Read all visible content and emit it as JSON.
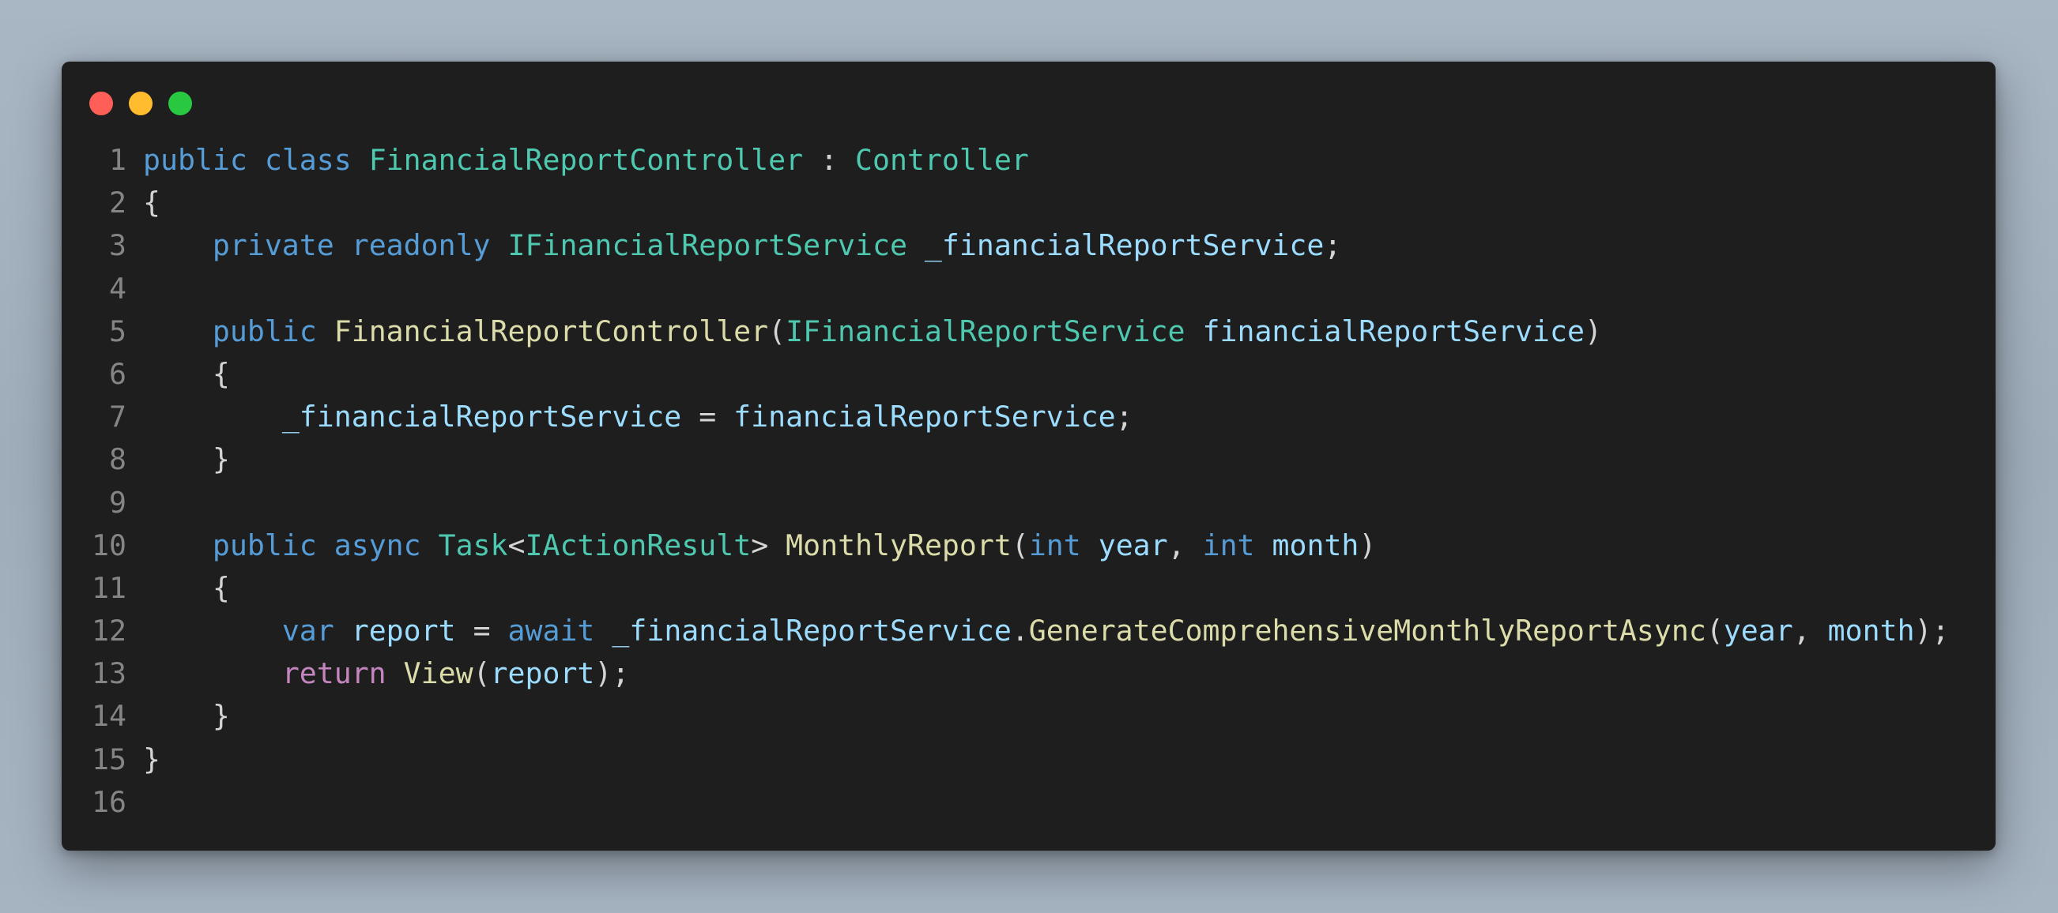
{
  "window": {
    "controls": [
      "close",
      "minimize",
      "maximize"
    ]
  },
  "colors": {
    "background": "#a6b3c1",
    "editor": "#1e1e1e",
    "keyword": "#569cd6",
    "control": "#c586c0",
    "type": "#4ec9b0",
    "function": "#dcdcaa",
    "variable": "#9cdcfe",
    "punctuation": "#d4d4d4",
    "line_number": "#858585"
  },
  "code": {
    "lines": [
      {
        "n": "1",
        "tokens": [
          {
            "t": "public",
            "c": "kw"
          },
          {
            "t": " ",
            "c": "pn"
          },
          {
            "t": "class",
            "c": "kw"
          },
          {
            "t": " ",
            "c": "pn"
          },
          {
            "t": "FinancialReportController",
            "c": "type"
          },
          {
            "t": " : ",
            "c": "pn"
          },
          {
            "t": "Controller",
            "c": "type"
          }
        ]
      },
      {
        "n": "2",
        "tokens": [
          {
            "t": "{",
            "c": "pn"
          }
        ]
      },
      {
        "n": "3",
        "tokens": [
          {
            "t": "    ",
            "c": "pn"
          },
          {
            "t": "private",
            "c": "kw"
          },
          {
            "t": " ",
            "c": "pn"
          },
          {
            "t": "readonly",
            "c": "kw"
          },
          {
            "t": " ",
            "c": "pn"
          },
          {
            "t": "IFinancialReportService",
            "c": "type"
          },
          {
            "t": " ",
            "c": "pn"
          },
          {
            "t": "_financialReportService",
            "c": "var"
          },
          {
            "t": ";",
            "c": "pn"
          }
        ]
      },
      {
        "n": "4",
        "tokens": []
      },
      {
        "n": "5",
        "tokens": [
          {
            "t": "    ",
            "c": "pn"
          },
          {
            "t": "public",
            "c": "kw"
          },
          {
            "t": " ",
            "c": "pn"
          },
          {
            "t": "FinancialReportController",
            "c": "fn"
          },
          {
            "t": "(",
            "c": "pn"
          },
          {
            "t": "IFinancialReportService",
            "c": "type"
          },
          {
            "t": " ",
            "c": "pn"
          },
          {
            "t": "financialReportService",
            "c": "var"
          },
          {
            "t": ")",
            "c": "pn"
          }
        ]
      },
      {
        "n": "6",
        "tokens": [
          {
            "t": "    {",
            "c": "pn"
          }
        ]
      },
      {
        "n": "7",
        "tokens": [
          {
            "t": "        ",
            "c": "pn"
          },
          {
            "t": "_financialReportService",
            "c": "var"
          },
          {
            "t": " = ",
            "c": "pn"
          },
          {
            "t": "financialReportService",
            "c": "var"
          },
          {
            "t": ";",
            "c": "pn"
          }
        ]
      },
      {
        "n": "8",
        "tokens": [
          {
            "t": "    }",
            "c": "pn"
          }
        ]
      },
      {
        "n": "9",
        "tokens": []
      },
      {
        "n": "10",
        "tokens": [
          {
            "t": "    ",
            "c": "pn"
          },
          {
            "t": "public",
            "c": "kw"
          },
          {
            "t": " ",
            "c": "pn"
          },
          {
            "t": "async",
            "c": "kw"
          },
          {
            "t": " ",
            "c": "pn"
          },
          {
            "t": "Task",
            "c": "type"
          },
          {
            "t": "<",
            "c": "pn"
          },
          {
            "t": "IActionResult",
            "c": "type"
          },
          {
            "t": "> ",
            "c": "pn"
          },
          {
            "t": "MonthlyReport",
            "c": "fn"
          },
          {
            "t": "(",
            "c": "pn"
          },
          {
            "t": "int",
            "c": "kw"
          },
          {
            "t": " ",
            "c": "pn"
          },
          {
            "t": "year",
            "c": "var"
          },
          {
            "t": ", ",
            "c": "pn"
          },
          {
            "t": "int",
            "c": "kw"
          },
          {
            "t": " ",
            "c": "pn"
          },
          {
            "t": "month",
            "c": "var"
          },
          {
            "t": ")",
            "c": "pn"
          }
        ]
      },
      {
        "n": "11",
        "tokens": [
          {
            "t": "    {",
            "c": "pn"
          }
        ]
      },
      {
        "n": "12",
        "tokens": [
          {
            "t": "        ",
            "c": "pn"
          },
          {
            "t": "var",
            "c": "kw"
          },
          {
            "t": " ",
            "c": "pn"
          },
          {
            "t": "report",
            "c": "var"
          },
          {
            "t": " = ",
            "c": "pn"
          },
          {
            "t": "await",
            "c": "kw"
          },
          {
            "t": " ",
            "c": "pn"
          },
          {
            "t": "_financialReportService",
            "c": "var"
          },
          {
            "t": ".",
            "c": "pn"
          },
          {
            "t": "GenerateComprehensiveMonthlyReportAsync",
            "c": "fn"
          },
          {
            "t": "(",
            "c": "pn"
          },
          {
            "t": "year",
            "c": "var"
          },
          {
            "t": ", ",
            "c": "pn"
          },
          {
            "t": "month",
            "c": "var"
          },
          {
            "t": ");",
            "c": "pn"
          }
        ]
      },
      {
        "n": "13",
        "tokens": [
          {
            "t": "        ",
            "c": "pn"
          },
          {
            "t": "return",
            "c": "ctl"
          },
          {
            "t": " ",
            "c": "pn"
          },
          {
            "t": "View",
            "c": "fn"
          },
          {
            "t": "(",
            "c": "pn"
          },
          {
            "t": "report",
            "c": "var"
          },
          {
            "t": ");",
            "c": "pn"
          }
        ]
      },
      {
        "n": "14",
        "tokens": [
          {
            "t": "    }",
            "c": "pn"
          }
        ]
      },
      {
        "n": "15",
        "tokens": [
          {
            "t": "}",
            "c": "pn"
          }
        ]
      },
      {
        "n": "16",
        "tokens": []
      }
    ]
  }
}
